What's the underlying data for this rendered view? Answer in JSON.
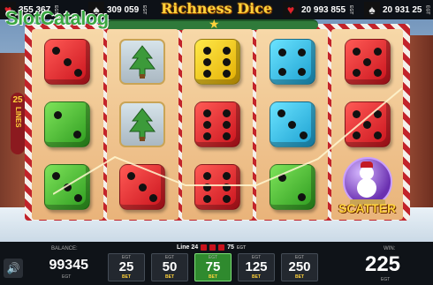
{
  "brand": "SlotCatalog",
  "game_title": "Richness Dice",
  "jackpots": [
    {
      "suit": "hearts",
      "symbol": "♥",
      "amount": "355 367",
      "currency": "EGT"
    },
    {
      "suit": "spades",
      "symbol": "♠",
      "amount": "309 059",
      "currency": "EGT"
    },
    {
      "suit": "hearts",
      "symbol": "♥",
      "amount": "20 993 855",
      "currency": "EGT"
    },
    {
      "suit": "spades",
      "symbol": "♠",
      "amount": "20 931 25",
      "currency": "EGT"
    }
  ],
  "lines_badge": {
    "count": "25",
    "label": "LINES"
  },
  "reels": [
    [
      "red-3",
      "green-2",
      "green-3"
    ],
    [
      "tree",
      "tree",
      "red-3"
    ],
    [
      "yellow-6",
      "red-6",
      "red-6"
    ],
    [
      "blue-4",
      "blue-3",
      "green-2"
    ],
    [
      "red-5",
      "red-5",
      "scatter"
    ]
  ],
  "scatter_label": "SCATTER",
  "bottom_bar": {
    "balance_label": "BALANCE:",
    "balance_value": "99345",
    "balance_currency": "EGT",
    "line_text": "Line 24",
    "line_win": "75",
    "line_currency": "EGT",
    "bets": [
      {
        "value": "25",
        "currency": "EGT",
        "label": "BET",
        "active": false
      },
      {
        "value": "50",
        "currency": "EGT",
        "label": "BET",
        "active": false
      },
      {
        "value": "75",
        "currency": "EGT",
        "label": "BET",
        "active": true
      },
      {
        "value": "125",
        "currency": "EGT",
        "label": "BET",
        "active": false
      },
      {
        "value": "250",
        "currency": "EGT",
        "label": "BET",
        "active": false
      }
    ],
    "win_label": "WIN:",
    "win_value": "225",
    "win_currency": "EGT"
  },
  "colors": {
    "dice_red": "#e0232b",
    "dice_green": "#3fbf2a",
    "dice_yellow": "#f5cc10",
    "dice_blue": "#2bbbe6",
    "active_bet": "#2f8a2e",
    "gold": "#ffd23a"
  }
}
